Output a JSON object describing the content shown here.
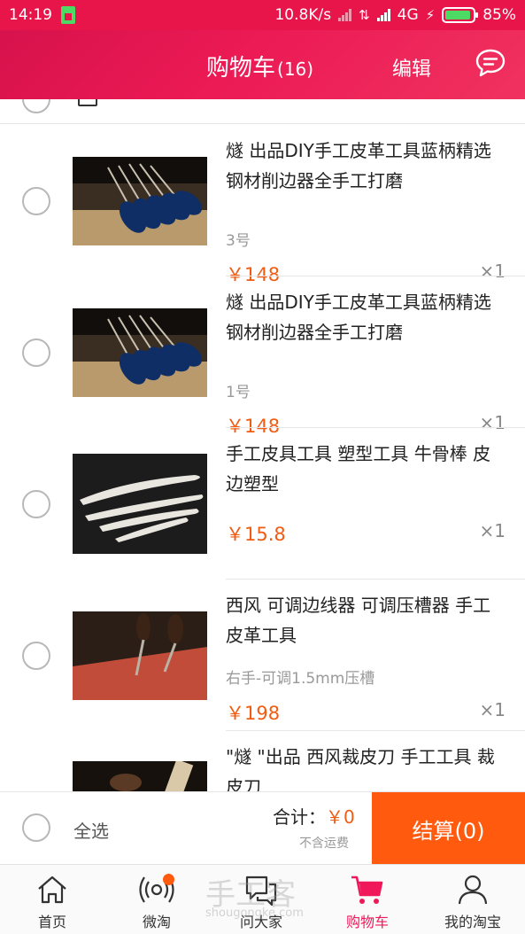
{
  "status_bar": {
    "time": "14:19",
    "net_speed": "10.8K/s",
    "network_type": "4G",
    "battery": "85%"
  },
  "header": {
    "title": "购物车",
    "count": "(16)",
    "edit_label": "编辑",
    "message_icon": "chat-bubble-icon"
  },
  "items": [
    {
      "title": "燧 出品DIY手工皮革工具蓝柄精选钢材削边器全手工打磨",
      "sku": "3号",
      "price": "￥148",
      "qty": "×1",
      "image": "blue-handled-edge-bevelers"
    },
    {
      "title": "燧 出品DIY手工皮革工具蓝柄精选钢材削边器全手工打磨",
      "sku": "1号",
      "price": "￥148",
      "qty": "×1",
      "image": "blue-handled-edge-bevelers"
    },
    {
      "title": "手工皮具工具 塑型工具 牛骨棒 皮边塑型",
      "sku": "",
      "price": "￥15.8",
      "qty": "×1",
      "image": "bone-folders"
    },
    {
      "title": "西风  可调边线器  可调压槽器  手工皮革工具",
      "sku": "右手-可调1.5mm压槽",
      "price": "￥198",
      "qty": "×1",
      "image": "adjustable-groovers"
    },
    {
      "title": "\"燧 \"出品   西风裁皮刀 手工工具 裁皮刀",
      "sku": "",
      "price": "",
      "qty": "",
      "image": "leather-knife"
    }
  ],
  "summary": {
    "select_all": "全选",
    "total_label": "合计：",
    "total_value": "￥0",
    "shipping_note": "不含运费",
    "checkout_label": "结算(0)"
  },
  "tabs": [
    {
      "label": "首页",
      "icon": "home-icon"
    },
    {
      "label": "微淘",
      "icon": "broadcast-icon"
    },
    {
      "label": "问大家",
      "icon": "qa-bubbles-icon"
    },
    {
      "label": "购物车",
      "icon": "shopping-cart-icon"
    },
    {
      "label": "我的淘宝",
      "icon": "person-icon"
    }
  ],
  "watermark": {
    "text": "手工客",
    "url": "shougongke.com"
  },
  "colors": {
    "brand": "#e8154a",
    "price": "#f25b12",
    "checkout": "#ff5a0e",
    "tab_active": "#f0175a"
  }
}
